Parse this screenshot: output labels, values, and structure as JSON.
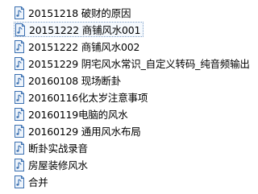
{
  "explorer": {
    "files": [
      {
        "name": "20151218  破财的原因",
        "icon": "audio-file-icon"
      },
      {
        "name": "20151222 商铺风水001",
        "icon": "audio-file-icon",
        "focused": true
      },
      {
        "name": "20151222 商铺风水002",
        "icon": "audio-file-icon"
      },
      {
        "name": "20151229 阴宅风水常识_自定义转码_纯音频输出",
        "icon": "audio-file-icon"
      },
      {
        "name": "20160108 现场断卦",
        "icon": "audio-file-icon"
      },
      {
        "name": "20160116化太岁注意事项",
        "icon": "audio-file-icon"
      },
      {
        "name": "20160119电脑的风水",
        "icon": "audio-file-icon"
      },
      {
        "name": "20160129 通用风水布局",
        "icon": "audio-file-icon"
      },
      {
        "name": "断卦实战录音",
        "icon": "audio-file-icon"
      },
      {
        "name": "房屋装修风水",
        "icon": "audio-file-icon"
      },
      {
        "name": "合并",
        "icon": "audio-file-icon"
      }
    ]
  },
  "colors": {
    "icon_outline": "#3a6fb0",
    "icon_fill": "#eef4fb",
    "focus_border": "#7a9cc6"
  }
}
